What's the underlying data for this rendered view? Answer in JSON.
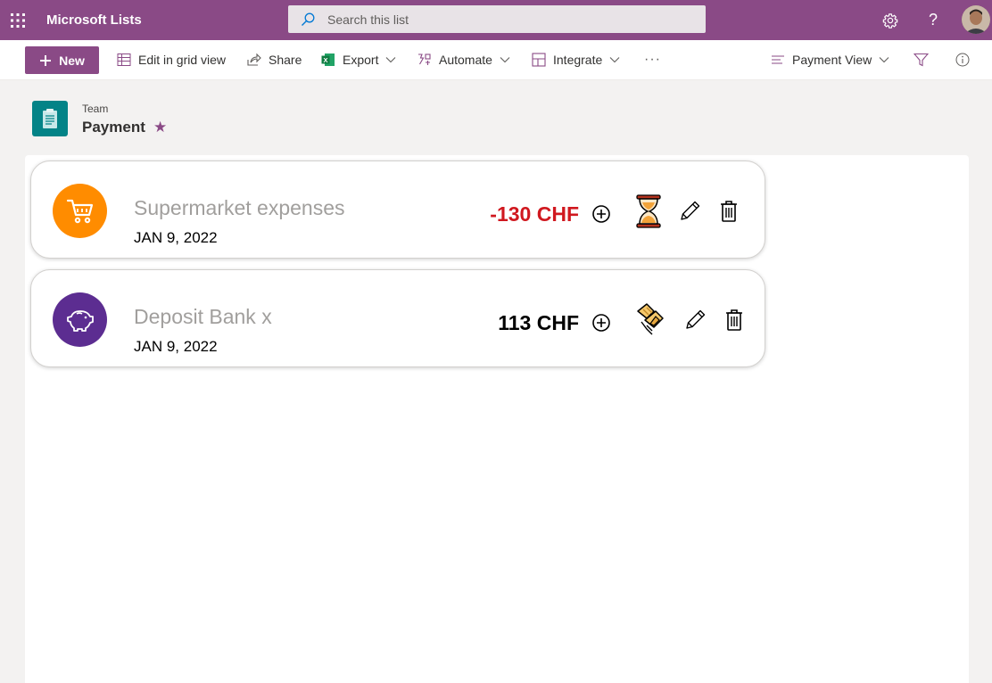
{
  "header": {
    "app_name": "Microsoft Lists",
    "search_placeholder": "Search this list",
    "accent_color": "#8a4a86"
  },
  "command_bar": {
    "new_label": "New",
    "edit_grid_label": "Edit in grid view",
    "share_label": "Share",
    "export_label": "Export",
    "automate_label": "Automate",
    "integrate_label": "Integrate",
    "more_label": "···",
    "view_label": "Payment View"
  },
  "list": {
    "breadcrumb": "Team",
    "title": "Payment",
    "favorite_icon": "★"
  },
  "items": [
    {
      "title": "Supermarket expenses",
      "date": "JAN 9, 2022",
      "amount": "-130 CHF",
      "amount_color": "#d0181f",
      "icon": "cart-icon",
      "icon_bg": "#ff8c00",
      "status_icon": "hourglass-icon"
    },
    {
      "title": "Deposit Bank x",
      "date": "JAN 9, 2022",
      "amount": "113 CHF",
      "amount_color": "#000000",
      "icon": "piggy-bank-icon",
      "icon_bg": "#5c2d91",
      "status_icon": "handshake-icon"
    }
  ]
}
